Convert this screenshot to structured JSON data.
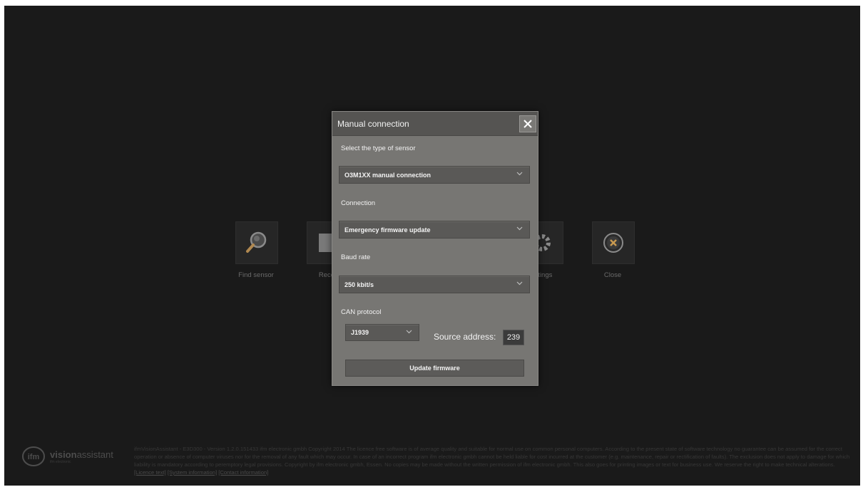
{
  "home": {
    "tiles": [
      {
        "label": "Find sensor",
        "icon": "search-icon"
      },
      {
        "label": "Rece",
        "icon": "recent-icon"
      },
      {
        "label": "ttings",
        "icon": "gear-icon"
      },
      {
        "label": "Close",
        "icon": "close-circle-icon"
      }
    ]
  },
  "dialog": {
    "title": "Manual connection",
    "sensor_type_label": "Select the type of sensor",
    "sensor_type_value": "O3M1XX manual connection",
    "connection_label": "Connection",
    "connection_value": "Emergency firmware update",
    "baud_rate_label": "Baud rate",
    "baud_rate_value": "250 kbit/s",
    "can_protocol_label": "CAN protocol",
    "can_protocol_value": "J1939",
    "source_address_label": "Source address:",
    "source_address_value": "239",
    "update_button": "Update firmware"
  },
  "footer": {
    "logo_brand_bold": "vision",
    "logo_brand_rest": "assistant",
    "logo_sub": "ifm electronic",
    "text": "ifmVisionAssistant - E3D300 - Version 1.2.0.151433 ifm electronic gmbh Copyright 2014 The licence free software is of average quality and suitable for normal use on common personal computers. According to the present state of software technology no guarantee can be assumed for the correct operation or absence of computer viruses nor for the removal of any fault which may occur. In case of an incorrect program ifm electronic gmbh cannot be held liable for cost incurred at the customer (e.g. maintenance, repair or rectification of faults). The exclusion does not apply to damage for which liability is mandatory according to peremptory legal provisions. Copyright by ifm electronic gmbh, Essen. No copies may be made without the written permission of ifm electronic gmbh. This also goes for printing images or text for business use. We reserve the right to make technical alterations.",
    "links": [
      "[Licence text]",
      "[System information]",
      "[Contact information]"
    ]
  },
  "colors": {
    "background": "#1a1a1a",
    "dialog": "#777673",
    "dialog_header": "#555452",
    "control": "#5a5957"
  }
}
